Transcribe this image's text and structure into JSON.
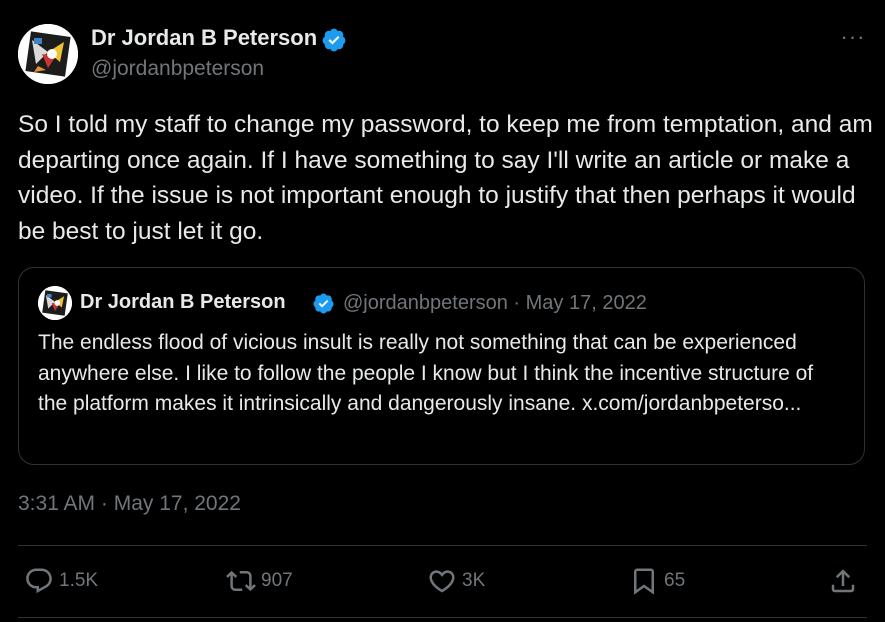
{
  "author": {
    "name": "Dr Jordan B Peterson",
    "handle": "@jordanbpeterson",
    "verified_color": "#1d9bf0"
  },
  "more_button": "···",
  "tweet_text": "So I told my staff to change my password, to keep me from temptation, and am departing once again. If I have something to say I'll write an article or make a video. If the issue is not important enough to justify that then perhaps it would be best to just let it go.",
  "quote": {
    "name": "Dr Jordan B Peterson",
    "meta": "@jordanbpeterson · May 17, 2022",
    "text": "The endless flood of vicious insult is really not something that can be experienced anywhere else. I like to follow the people I know but I think the incentive structure of the platform makes it intrinsically and dangerously insane. x.com/jordanbpeterso..."
  },
  "timestamp": "3:31 AM · May 17, 2022",
  "actions": {
    "reply": {
      "icon": "reply-icon",
      "count": "1.5K"
    },
    "retweet": {
      "icon": "retweet-icon",
      "count": "907"
    },
    "like": {
      "icon": "heart-icon",
      "count": "3K"
    },
    "bookmark": {
      "icon": "bookmark-icon",
      "count": "65"
    },
    "share": {
      "icon": "share-icon"
    }
  },
  "colors": {
    "background": "#000000",
    "text": "#e7e9ea",
    "muted": "#71767b",
    "border": "#2f3336"
  }
}
